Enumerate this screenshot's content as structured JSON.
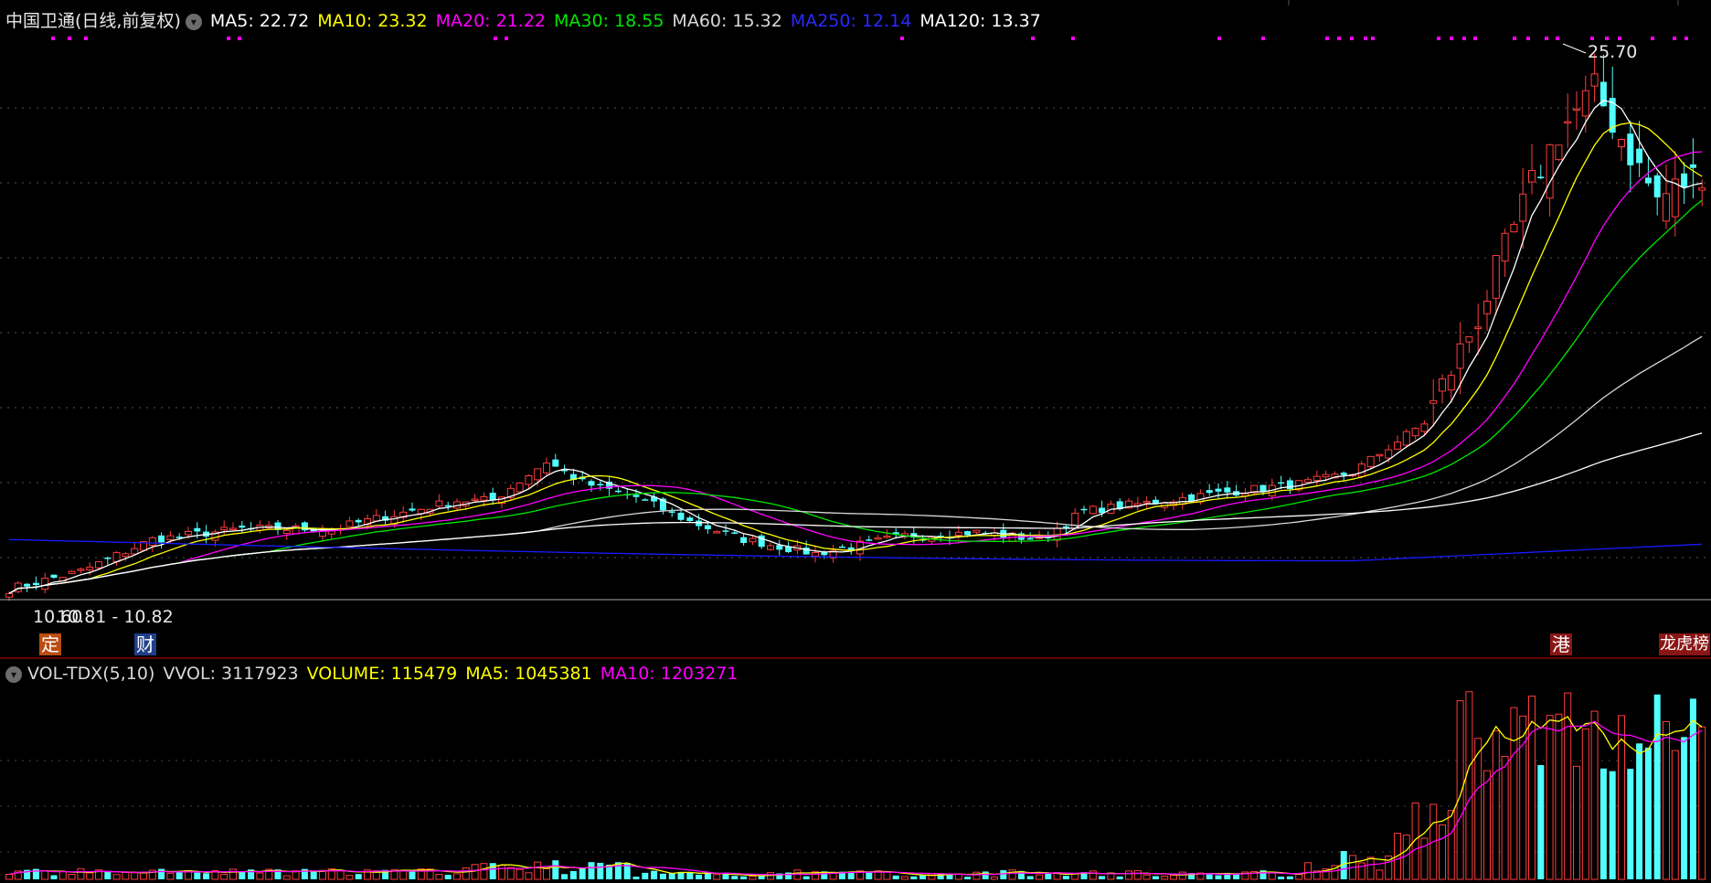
{
  "price_legend": {
    "stock": "中国卫通(日线,前复权)",
    "ma5": "MA5: 22.72",
    "ma10": "MA10: 23.32",
    "ma20": "MA20: 21.22",
    "ma30": "MA30: 18.55",
    "ma60": "MA60: 15.32",
    "ma250": "MA250: 12.14",
    "ma120": "MA120: 13.37"
  },
  "volume_legend": {
    "title": "VOL-TDX(5,10)",
    "vvol": "VVOL: 3117923",
    "volume": "VOLUME: 115479",
    "ma5": "MA5: 1045381",
    "ma10": "MA10: 1203271"
  },
  "annotations": {
    "high": "25.70",
    "low": "10.60",
    "low2": "10.81 - 10.82"
  },
  "tags": [
    {
      "text": "定",
      "bg": "#b94e12"
    },
    {
      "text": "财",
      "bg": "#1f3f8a"
    },
    {
      "text": "港",
      "bg": "#8a1515"
    },
    {
      "text": "龙虎榜",
      "bg": "#8a1515"
    }
  ],
  "colors": {
    "up": "#ff3c3c",
    "down": "#52ffff",
    "ma5": "#ffffff",
    "ma10": "#ffff00",
    "ma20": "#ff00ff",
    "ma30": "#00e600",
    "ma60": "#d8d8d8",
    "ma250": "#1a1aff",
    "ma120": "#ffffff",
    "vol_ma5": "#ffff00",
    "vol_ma10": "#ff00ff",
    "signal": "#ff00ff"
  },
  "chart_data": {
    "type": "candlestick",
    "price_range": [
      10.5,
      26.5
    ],
    "volume_range": [
      0,
      1700000
    ],
    "candle_count": 190
  }
}
